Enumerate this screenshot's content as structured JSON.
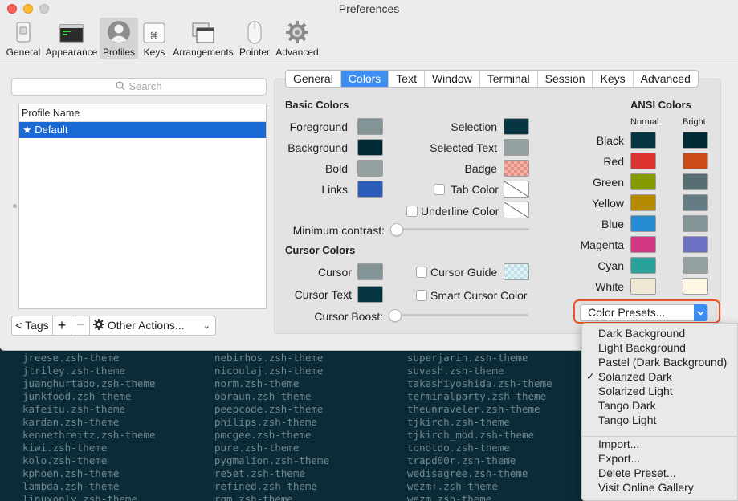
{
  "window": {
    "title": "Preferences"
  },
  "toolbar": {
    "items": [
      {
        "label": "General",
        "icon": "general-switch-icon"
      },
      {
        "label": "Appearance",
        "icon": "appearance-window-icon"
      },
      {
        "label": "Profiles",
        "icon": "profiles-person-icon",
        "active": true
      },
      {
        "label": "Keys",
        "icon": "keys-command-icon"
      },
      {
        "label": "Arrangements",
        "icon": "arrangements-windows-icon"
      },
      {
        "label": "Pointer",
        "icon": "pointer-mouse-icon"
      },
      {
        "label": "Advanced",
        "icon": "advanced-gear-icon"
      }
    ]
  },
  "profiles": {
    "search_placeholder": "Search",
    "column_header": "Profile Name",
    "rows": [
      "★ Default"
    ],
    "tags_button": "< Tags",
    "add_button": "+",
    "remove_button": "−",
    "other_actions": "Other Actions..."
  },
  "tabs": [
    "General",
    "Colors",
    "Text",
    "Window",
    "Terminal",
    "Session",
    "Keys",
    "Advanced"
  ],
  "active_tab": "Colors",
  "basic_colors": {
    "title": "Basic Colors",
    "items": [
      {
        "label": "Foreground",
        "color": "#839496"
      },
      {
        "label": "Background",
        "color": "#002b36"
      },
      {
        "label": "Bold",
        "color": "#93a1a1"
      },
      {
        "label": "Links",
        "color": "#2a5cb8"
      }
    ],
    "right_items": [
      {
        "label": "Selection",
        "color": "#073642"
      },
      {
        "label": "Selected Text",
        "color": "#93a1a1"
      },
      {
        "label": "Badge",
        "color": "checker-red"
      },
      {
        "label": "Tab Color",
        "color": "none",
        "checkbox": true
      },
      {
        "label": "Underline Color",
        "color": "none",
        "checkbox": true
      }
    ]
  },
  "minimum_contrast": {
    "label": "Minimum contrast:",
    "value": 0
  },
  "cursor_colors": {
    "title": "Cursor Colors",
    "cursor_label": "Cursor",
    "cursor_color": "#839496",
    "cursor_text_label": "Cursor Text",
    "cursor_text_color": "#073642",
    "cursor_guide_label": "Cursor Guide",
    "smart_cursor_label": "Smart Cursor Color"
  },
  "cursor_boost": {
    "label": "Cursor Boost:",
    "value": 0
  },
  "ansi": {
    "title": "ANSI Colors",
    "normal_header": "Normal",
    "bright_header": "Bright",
    "rows": [
      {
        "name": "Black",
        "normal": "#073642",
        "bright": "#002b36"
      },
      {
        "name": "Red",
        "normal": "#dc322f",
        "bright": "#cb4b16"
      },
      {
        "name": "Green",
        "normal": "#859900",
        "bright": "#586e75"
      },
      {
        "name": "Yellow",
        "normal": "#b58900",
        "bright": "#657b83"
      },
      {
        "name": "Blue",
        "normal": "#268bd2",
        "bright": "#839496"
      },
      {
        "name": "Magenta",
        "normal": "#d33682",
        "bright": "#6c71c4"
      },
      {
        "name": "Cyan",
        "normal": "#2aa198",
        "bright": "#93a1a1"
      },
      {
        "name": "White",
        "normal": "#eee8d5",
        "bright": "#fdf6e3"
      }
    ]
  },
  "color_presets": {
    "label": "Color Presets...",
    "menu_items": [
      "Dark Background",
      "Light Background",
      "Pastel (Dark Background)",
      "Solarized Dark",
      "Solarized Light",
      "Tango Dark",
      "Tango Light"
    ],
    "checked": "Solarized Dark",
    "action_items": [
      "Import...",
      "Export...",
      "Delete Preset...",
      "Visit Online Gallery"
    ]
  },
  "terminal": {
    "col1": [
      "jreese.zsh-theme",
      "jtriley.zsh-theme",
      "juanghurtado.zsh-theme",
      "junkfood.zsh-theme",
      "kafeitu.zsh-theme",
      "kardan.zsh-theme",
      "kennethreitz.zsh-theme",
      "kiwi.zsh-theme",
      "kolo.zsh-theme",
      "kphoen.zsh-theme",
      "lambda.zsh-theme",
      "linuxonly.zsh-theme"
    ],
    "col2": [
      "nebirhos.zsh-theme",
      "nicoulaj.zsh-theme",
      "norm.zsh-theme",
      "obraun.zsh-theme",
      "peepcode.zsh-theme",
      "philips.zsh-theme",
      "pmcgee.zsh-theme",
      "pure.zsh-theme",
      "pygmalion.zsh-theme",
      "re5et.zsh-theme",
      "refined.zsh-theme",
      "rgm.zsh-theme"
    ],
    "col3": [
      "superjarin.zsh-theme",
      "suvash.zsh-theme",
      "takashiyoshida.zsh-theme",
      "terminalparty.zsh-theme",
      "theunraveler.zsh-theme",
      "tjkirch.zsh-theme",
      "tjkirch_mod.zsh-theme",
      "tonotdo.zsh-theme",
      "trapd00r.zsh-theme",
      "wedisagree.zsh-theme",
      "wezm+.zsh-theme",
      "wezm.zsh-theme"
    ]
  }
}
